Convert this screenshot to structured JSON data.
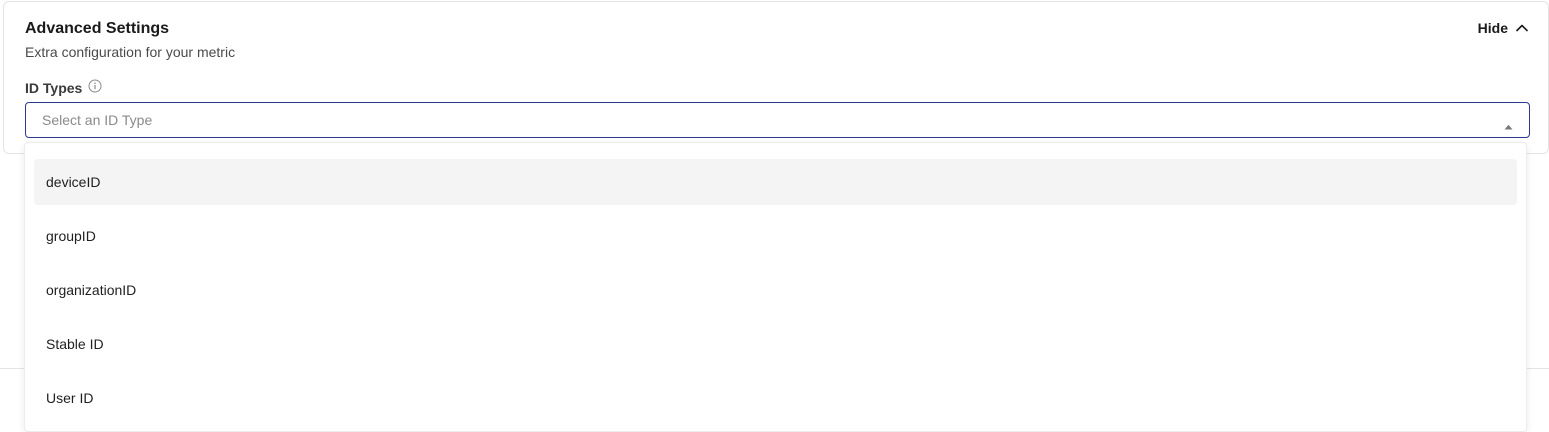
{
  "section": {
    "title": "Advanced Settings",
    "subtitle": "Extra configuration for your metric",
    "hide_label": "Hide"
  },
  "id_types": {
    "label": "ID Types",
    "placeholder": "Select an ID Type",
    "options": [
      {
        "label": "deviceID",
        "highlighted": true
      },
      {
        "label": "groupID",
        "highlighted": false
      },
      {
        "label": "organizationID",
        "highlighted": false
      },
      {
        "label": "Stable ID",
        "highlighted": false
      },
      {
        "label": "User ID",
        "highlighted": false
      }
    ]
  },
  "icons": {
    "hide": "chevron-up-icon",
    "info": "info-icon",
    "caret": "caret-up-icon"
  },
  "colors": {
    "select_border": "#2b3a8f",
    "highlight_bg": "#f4f4f4"
  }
}
